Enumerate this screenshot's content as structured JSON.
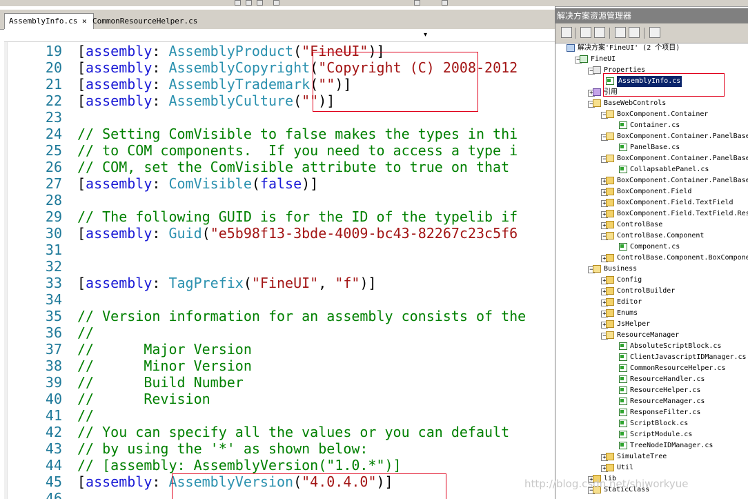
{
  "editor": {
    "tabs": [
      {
        "label": "AssemblyInfo.cs",
        "close": "✕"
      },
      {
        "label": "CommonResourceHelper.cs"
      }
    ],
    "nav_dropdown": "▾",
    "lines": [
      {
        "n": "19",
        "parts": [
          {
            "c": "p",
            "t": "["
          },
          {
            "c": "kw",
            "t": "assembly"
          },
          {
            "c": "p",
            "t": ": "
          },
          {
            "c": "ty",
            "t": "AssemblyProduct"
          },
          {
            "c": "p",
            "t": "("
          },
          {
            "c": "st",
            "t": "\"FineUI\""
          },
          {
            "c": "p",
            "t": ")]"
          }
        ]
      },
      {
        "n": "20",
        "parts": [
          {
            "c": "p",
            "t": "["
          },
          {
            "c": "kw",
            "t": "assembly"
          },
          {
            "c": "p",
            "t": ": "
          },
          {
            "c": "ty",
            "t": "AssemblyCopyright"
          },
          {
            "c": "p",
            "t": "("
          },
          {
            "c": "st",
            "t": "\"Copyright (C) 2008-2012"
          }
        ]
      },
      {
        "n": "21",
        "parts": [
          {
            "c": "p",
            "t": "["
          },
          {
            "c": "kw",
            "t": "assembly"
          },
          {
            "c": "p",
            "t": ": "
          },
          {
            "c": "ty",
            "t": "AssemblyTrademark"
          },
          {
            "c": "p",
            "t": "("
          },
          {
            "c": "st",
            "t": "\"\""
          },
          {
            "c": "p",
            "t": ")]"
          }
        ]
      },
      {
        "n": "22",
        "parts": [
          {
            "c": "p",
            "t": "["
          },
          {
            "c": "kw",
            "t": "assembly"
          },
          {
            "c": "p",
            "t": ": "
          },
          {
            "c": "ty",
            "t": "AssemblyCulture"
          },
          {
            "c": "p",
            "t": "("
          },
          {
            "c": "st",
            "t": "\"\""
          },
          {
            "c": "p",
            "t": ")]"
          }
        ]
      },
      {
        "n": "23",
        "parts": []
      },
      {
        "n": "24",
        "parts": [
          {
            "c": "cm",
            "t": "// Setting ComVisible to false makes the types in thi"
          }
        ]
      },
      {
        "n": "25",
        "parts": [
          {
            "c": "cm",
            "t": "// to COM components.  If you need to access a type i"
          }
        ]
      },
      {
        "n": "26",
        "parts": [
          {
            "c": "cm",
            "t": "// COM, set the ComVisible attribute to true on that "
          }
        ]
      },
      {
        "n": "27",
        "parts": [
          {
            "c": "p",
            "t": "["
          },
          {
            "c": "kw",
            "t": "assembly"
          },
          {
            "c": "p",
            "t": ": "
          },
          {
            "c": "ty",
            "t": "ComVisible"
          },
          {
            "c": "p",
            "t": "("
          },
          {
            "c": "kw",
            "t": "false"
          },
          {
            "c": "p",
            "t": ")]"
          }
        ]
      },
      {
        "n": "28",
        "parts": []
      },
      {
        "n": "29",
        "parts": [
          {
            "c": "cm",
            "t": "// The following GUID is for the ID of the typelib if"
          }
        ]
      },
      {
        "n": "30",
        "parts": [
          {
            "c": "p",
            "t": "["
          },
          {
            "c": "kw",
            "t": "assembly"
          },
          {
            "c": "p",
            "t": ": "
          },
          {
            "c": "ty",
            "t": "Guid"
          },
          {
            "c": "p",
            "t": "("
          },
          {
            "c": "st",
            "t": "\"e5b98f13-3bde-4009-bc43-82267c23c5f6"
          }
        ]
      },
      {
        "n": "31",
        "parts": []
      },
      {
        "n": "32",
        "parts": []
      },
      {
        "n": "33",
        "parts": [
          {
            "c": "p",
            "t": "["
          },
          {
            "c": "kw",
            "t": "assembly"
          },
          {
            "c": "p",
            "t": ": "
          },
          {
            "c": "ty",
            "t": "TagPrefix"
          },
          {
            "c": "p",
            "t": "("
          },
          {
            "c": "st",
            "t": "\"FineUI\""
          },
          {
            "c": "p",
            "t": ", "
          },
          {
            "c": "st",
            "t": "\"f\""
          },
          {
            "c": "p",
            "t": ")]"
          }
        ]
      },
      {
        "n": "34",
        "parts": []
      },
      {
        "n": "35",
        "parts": [
          {
            "c": "cm",
            "t": "// Version information for an assembly consists of the"
          }
        ]
      },
      {
        "n": "36",
        "parts": [
          {
            "c": "cm",
            "t": "//"
          }
        ]
      },
      {
        "n": "37",
        "parts": [
          {
            "c": "cm",
            "t": "//      Major Version"
          }
        ]
      },
      {
        "n": "38",
        "parts": [
          {
            "c": "cm",
            "t": "//      Minor Version"
          }
        ]
      },
      {
        "n": "39",
        "parts": [
          {
            "c": "cm",
            "t": "//      Build Number"
          }
        ]
      },
      {
        "n": "40",
        "parts": [
          {
            "c": "cm",
            "t": "//      Revision"
          }
        ]
      },
      {
        "n": "41",
        "parts": [
          {
            "c": "cm",
            "t": "//"
          }
        ]
      },
      {
        "n": "42",
        "parts": [
          {
            "c": "cm",
            "t": "// You can specify all the values or you can default "
          }
        ]
      },
      {
        "n": "43",
        "parts": [
          {
            "c": "cm",
            "t": "// by using the '*' as shown below:"
          }
        ]
      },
      {
        "n": "44",
        "parts": [
          {
            "c": "cm",
            "t": "// [assembly: AssemblyVersion(\"1.0.*\")]"
          }
        ]
      },
      {
        "n": "45",
        "parts": [
          {
            "c": "p",
            "t": "["
          },
          {
            "c": "kw",
            "t": "assembly"
          },
          {
            "c": "p",
            "t": ": "
          },
          {
            "c": "ty",
            "t": "AssemblyVersion"
          },
          {
            "c": "p",
            "t": "("
          },
          {
            "c": "st",
            "t": "\"4.0.4.0\""
          },
          {
            "c": "p",
            "t": ")]"
          }
        ]
      },
      {
        "n": "46",
        "parts": []
      }
    ],
    "highlight_color": "#e0001b"
  },
  "explorer": {
    "title": "解决方案资源管理器",
    "tree": [
      {
        "d": 0,
        "exp": "",
        "icon": "sol",
        "label": "解决方案'FineUI' (2 个项目)"
      },
      {
        "d": 1,
        "exp": "−",
        "icon": "proj",
        "label": "FineUI"
      },
      {
        "d": 2,
        "exp": "−",
        "icon": "props",
        "label": "Properties"
      },
      {
        "d": 3,
        "exp": "",
        "icon": "cs",
        "label": "AssemblyInfo.cs",
        "selected": true
      },
      {
        "d": 2,
        "exp": "+",
        "icon": "ref",
        "label": "引用"
      },
      {
        "d": 2,
        "exp": "−",
        "icon": "folder",
        "label": "BaseWebControls"
      },
      {
        "d": 3,
        "exp": "−",
        "icon": "folder",
        "label": "BoxComponent.Container"
      },
      {
        "d": 4,
        "exp": "",
        "icon": "cs",
        "label": "Container.cs"
      },
      {
        "d": 3,
        "exp": "−",
        "icon": "folder",
        "label": "BoxComponent.Container.PanelBase"
      },
      {
        "d": 4,
        "exp": "",
        "icon": "cs",
        "label": "PanelBase.cs"
      },
      {
        "d": 3,
        "exp": "−",
        "icon": "folder",
        "label": "BoxComponent.Container.PanelBase"
      },
      {
        "d": 4,
        "exp": "",
        "icon": "cs",
        "label": "CollapsablePanel.cs"
      },
      {
        "d": 3,
        "exp": "+",
        "icon": "folder",
        "label": "BoxComponent.Container.PanelBase"
      },
      {
        "d": 3,
        "exp": "+",
        "icon": "folder",
        "label": "BoxComponent.Field"
      },
      {
        "d": 3,
        "exp": "+",
        "icon": "folder",
        "label": "BoxComponent.Field.TextField"
      },
      {
        "d": 3,
        "exp": "+",
        "icon": "folder",
        "label": "BoxComponent.Field.TextField.Res"
      },
      {
        "d": 3,
        "exp": "+",
        "icon": "folder",
        "label": "ControlBase"
      },
      {
        "d": 3,
        "exp": "−",
        "icon": "folder",
        "label": "ControlBase.Component"
      },
      {
        "d": 4,
        "exp": "",
        "icon": "cs",
        "label": "Component.cs"
      },
      {
        "d": 3,
        "exp": "+",
        "icon": "folder",
        "label": "ControlBase.Component.BoxCompone"
      },
      {
        "d": 2,
        "exp": "−",
        "icon": "folder",
        "label": "Business"
      },
      {
        "d": 3,
        "exp": "+",
        "icon": "folder",
        "label": "Config"
      },
      {
        "d": 3,
        "exp": "+",
        "icon": "folder",
        "label": "ControlBuilder"
      },
      {
        "d": 3,
        "exp": "+",
        "icon": "folder",
        "label": "Editor"
      },
      {
        "d": 3,
        "exp": "+",
        "icon": "folder",
        "label": "Enums"
      },
      {
        "d": 3,
        "exp": "+",
        "icon": "folder",
        "label": "JsHelper"
      },
      {
        "d": 3,
        "exp": "−",
        "icon": "folder",
        "label": "ResourceManager"
      },
      {
        "d": 4,
        "exp": "",
        "icon": "cs",
        "label": "AbsoluteScriptBlock.cs"
      },
      {
        "d": 4,
        "exp": "",
        "icon": "cs",
        "label": "ClientJavascriptIDManager.cs"
      },
      {
        "d": 4,
        "exp": "",
        "icon": "cs",
        "label": "CommonResourceHelper.cs"
      },
      {
        "d": 4,
        "exp": "",
        "icon": "cs",
        "label": "ResourceHandler.cs"
      },
      {
        "d": 4,
        "exp": "",
        "icon": "cs",
        "label": "ResourceHelper.cs"
      },
      {
        "d": 4,
        "exp": "",
        "icon": "cs",
        "label": "ResourceManager.cs"
      },
      {
        "d": 4,
        "exp": "",
        "icon": "cs",
        "label": "ResponseFilter.cs"
      },
      {
        "d": 4,
        "exp": "",
        "icon": "cs",
        "label": "ScriptBlock.cs"
      },
      {
        "d": 4,
        "exp": "",
        "icon": "cs",
        "label": "ScriptModule.cs"
      },
      {
        "d": 4,
        "exp": "",
        "icon": "cs",
        "label": "TreeNodeIDManager.cs"
      },
      {
        "d": 3,
        "exp": "+",
        "icon": "folder",
        "label": "SimulateTree"
      },
      {
        "d": 3,
        "exp": "+",
        "icon": "folder",
        "label": "Util"
      },
      {
        "d": 2,
        "exp": "+",
        "icon": "folder",
        "label": "lib"
      },
      {
        "d": 2,
        "exp": "−",
        "icon": "folder",
        "label": "StaticClass"
      }
    ]
  },
  "watermark": "http://blog.csdn.net/shiworkyue"
}
